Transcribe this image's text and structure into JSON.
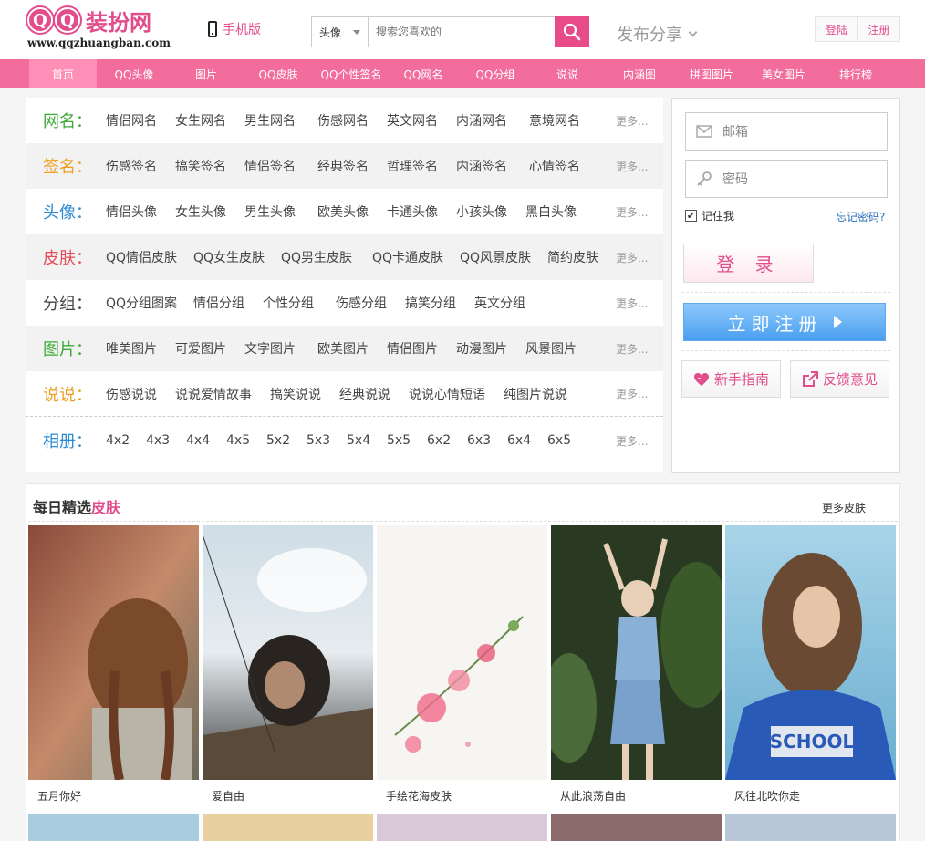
{
  "header": {
    "logo_letters": [
      "Q",
      "Q"
    ],
    "logo_cn": "装扮网",
    "logo_url": "www.qqzhuangban.com",
    "mobile_label": "手机版",
    "search": {
      "category": "头像",
      "placeholder": "搜索您喜欢的"
    },
    "share_label": "发布分享",
    "login_label": "登陆",
    "register_label": "注册"
  },
  "nav": {
    "items": [
      "首页",
      "QQ头像",
      "图片",
      "QQ皮肤",
      "QQ个性签名",
      "QQ网名",
      "QQ分组",
      "说说",
      "内涵图",
      "拼图图片",
      "美女图片",
      "排行榜"
    ],
    "active": "首页"
  },
  "categories": [
    {
      "title": "网名：",
      "color": "#3aaa35",
      "links": [
        "情侣网名",
        "女生网名",
        "男生网名",
        "伤感网名",
        "英文网名",
        "内涵网名",
        "意境网名"
      ],
      "more": "更多..."
    },
    {
      "title": "签名：",
      "color": "#f0a020",
      "links": [
        "伤感签名",
        "搞笑签名",
        "情侣签名",
        "经典签名",
        "哲理签名",
        "内涵签名",
        "心情签名"
      ],
      "more": "更多..."
    },
    {
      "title": "头像：",
      "color": "#2a8ad4",
      "links": [
        "情侣头像",
        "女生头像",
        "男生头像",
        "欧美头像",
        "卡通头像",
        "小孩头像",
        "黑白头像"
      ],
      "more": "更多..."
    },
    {
      "title": "皮肤：",
      "color": "#e24d5a",
      "links": [
        "QQ情侣皮肤",
        "QQ女生皮肤",
        "QQ男生皮肤",
        "QQ卡通皮肤",
        "QQ风景皮肤",
        "简约皮肤"
      ],
      "more": "更多..."
    },
    {
      "title": "分组：",
      "color": "#444444",
      "links": [
        "QQ分组图案",
        "情侣分组",
        "个性分组",
        "伤感分组",
        "搞笑分组",
        "英文分组"
      ],
      "more": "更多..."
    },
    {
      "title": "图片：",
      "color": "#3aaa35",
      "links": [
        "唯美图片",
        "可爱图片",
        "文字图片",
        "欧美图片",
        "情侣图片",
        "动漫图片",
        "风景图片"
      ],
      "more": "更多..."
    },
    {
      "title": "说说：",
      "color": "#f0a020",
      "links": [
        "伤感说说",
        "说说爱情故事",
        "搞笑说说",
        "经典说说",
        "说说心情短语",
        "纯图片说说"
      ],
      "more": "更多..."
    },
    {
      "title": "相册：",
      "color": "#2a8ad4",
      "links": [
        "4x2",
        "4x3",
        "4x4",
        "4x5",
        "5x2",
        "5x3",
        "5x4",
        "5x5",
        "6x2",
        "6x3",
        "6x4",
        "6x5"
      ],
      "more": "更多..."
    }
  ],
  "login": {
    "email_placeholder": "邮箱",
    "password_placeholder": "密码",
    "remember_label": "记住我",
    "remember_checked": true,
    "forgot_label": "忘记密码?",
    "login_button": "登 录",
    "register_button": "立即注册",
    "guide_button": "新手指南",
    "feedback_button": "反馈意见"
  },
  "daily": {
    "title_prefix": "每日精选",
    "title_highlight": "皮肤",
    "more_label": "更多皮肤",
    "cards": [
      {
        "caption": "五月你好"
      },
      {
        "caption": "爱自由"
      },
      {
        "caption": "手绘花海皮肤"
      },
      {
        "caption": "从此浪荡自由"
      },
      {
        "caption": "风往北吹你走"
      }
    ]
  },
  "colors": {
    "brand_pink": "#e24d8c",
    "nav_bg": "#f26c9c",
    "register_blue": "#4a9ff0"
  }
}
